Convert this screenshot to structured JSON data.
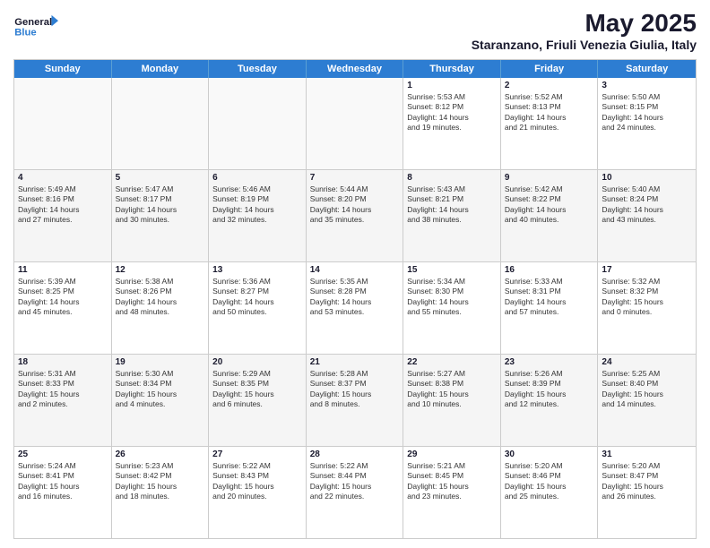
{
  "logo": {
    "line1": "General",
    "line2": "Blue"
  },
  "title": "May 2025",
  "location": "Staranzano, Friuli Venezia Giulia, Italy",
  "days_of_week": [
    "Sunday",
    "Monday",
    "Tuesday",
    "Wednesday",
    "Thursday",
    "Friday",
    "Saturday"
  ],
  "weeks": [
    [
      {
        "day": "",
        "info": ""
      },
      {
        "day": "",
        "info": ""
      },
      {
        "day": "",
        "info": ""
      },
      {
        "day": "",
        "info": ""
      },
      {
        "day": "1",
        "info": "Sunrise: 5:53 AM\nSunset: 8:12 PM\nDaylight: 14 hours\nand 19 minutes."
      },
      {
        "day": "2",
        "info": "Sunrise: 5:52 AM\nSunset: 8:13 PM\nDaylight: 14 hours\nand 21 minutes."
      },
      {
        "day": "3",
        "info": "Sunrise: 5:50 AM\nSunset: 8:15 PM\nDaylight: 14 hours\nand 24 minutes."
      }
    ],
    [
      {
        "day": "4",
        "info": "Sunrise: 5:49 AM\nSunset: 8:16 PM\nDaylight: 14 hours\nand 27 minutes."
      },
      {
        "day": "5",
        "info": "Sunrise: 5:47 AM\nSunset: 8:17 PM\nDaylight: 14 hours\nand 30 minutes."
      },
      {
        "day": "6",
        "info": "Sunrise: 5:46 AM\nSunset: 8:19 PM\nDaylight: 14 hours\nand 32 minutes."
      },
      {
        "day": "7",
        "info": "Sunrise: 5:44 AM\nSunset: 8:20 PM\nDaylight: 14 hours\nand 35 minutes."
      },
      {
        "day": "8",
        "info": "Sunrise: 5:43 AM\nSunset: 8:21 PM\nDaylight: 14 hours\nand 38 minutes."
      },
      {
        "day": "9",
        "info": "Sunrise: 5:42 AM\nSunset: 8:22 PM\nDaylight: 14 hours\nand 40 minutes."
      },
      {
        "day": "10",
        "info": "Sunrise: 5:40 AM\nSunset: 8:24 PM\nDaylight: 14 hours\nand 43 minutes."
      }
    ],
    [
      {
        "day": "11",
        "info": "Sunrise: 5:39 AM\nSunset: 8:25 PM\nDaylight: 14 hours\nand 45 minutes."
      },
      {
        "day": "12",
        "info": "Sunrise: 5:38 AM\nSunset: 8:26 PM\nDaylight: 14 hours\nand 48 minutes."
      },
      {
        "day": "13",
        "info": "Sunrise: 5:36 AM\nSunset: 8:27 PM\nDaylight: 14 hours\nand 50 minutes."
      },
      {
        "day": "14",
        "info": "Sunrise: 5:35 AM\nSunset: 8:28 PM\nDaylight: 14 hours\nand 53 minutes."
      },
      {
        "day": "15",
        "info": "Sunrise: 5:34 AM\nSunset: 8:30 PM\nDaylight: 14 hours\nand 55 minutes."
      },
      {
        "day": "16",
        "info": "Sunrise: 5:33 AM\nSunset: 8:31 PM\nDaylight: 14 hours\nand 57 minutes."
      },
      {
        "day": "17",
        "info": "Sunrise: 5:32 AM\nSunset: 8:32 PM\nDaylight: 15 hours\nand 0 minutes."
      }
    ],
    [
      {
        "day": "18",
        "info": "Sunrise: 5:31 AM\nSunset: 8:33 PM\nDaylight: 15 hours\nand 2 minutes."
      },
      {
        "day": "19",
        "info": "Sunrise: 5:30 AM\nSunset: 8:34 PM\nDaylight: 15 hours\nand 4 minutes."
      },
      {
        "day": "20",
        "info": "Sunrise: 5:29 AM\nSunset: 8:35 PM\nDaylight: 15 hours\nand 6 minutes."
      },
      {
        "day": "21",
        "info": "Sunrise: 5:28 AM\nSunset: 8:37 PM\nDaylight: 15 hours\nand 8 minutes."
      },
      {
        "day": "22",
        "info": "Sunrise: 5:27 AM\nSunset: 8:38 PM\nDaylight: 15 hours\nand 10 minutes."
      },
      {
        "day": "23",
        "info": "Sunrise: 5:26 AM\nSunset: 8:39 PM\nDaylight: 15 hours\nand 12 minutes."
      },
      {
        "day": "24",
        "info": "Sunrise: 5:25 AM\nSunset: 8:40 PM\nDaylight: 15 hours\nand 14 minutes."
      }
    ],
    [
      {
        "day": "25",
        "info": "Sunrise: 5:24 AM\nSunset: 8:41 PM\nDaylight: 15 hours\nand 16 minutes."
      },
      {
        "day": "26",
        "info": "Sunrise: 5:23 AM\nSunset: 8:42 PM\nDaylight: 15 hours\nand 18 minutes."
      },
      {
        "day": "27",
        "info": "Sunrise: 5:22 AM\nSunset: 8:43 PM\nDaylight: 15 hours\nand 20 minutes."
      },
      {
        "day": "28",
        "info": "Sunrise: 5:22 AM\nSunset: 8:44 PM\nDaylight: 15 hours\nand 22 minutes."
      },
      {
        "day": "29",
        "info": "Sunrise: 5:21 AM\nSunset: 8:45 PM\nDaylight: 15 hours\nand 23 minutes."
      },
      {
        "day": "30",
        "info": "Sunrise: 5:20 AM\nSunset: 8:46 PM\nDaylight: 15 hours\nand 25 minutes."
      },
      {
        "day": "31",
        "info": "Sunrise: 5:20 AM\nSunset: 8:47 PM\nDaylight: 15 hours\nand 26 minutes."
      }
    ]
  ]
}
